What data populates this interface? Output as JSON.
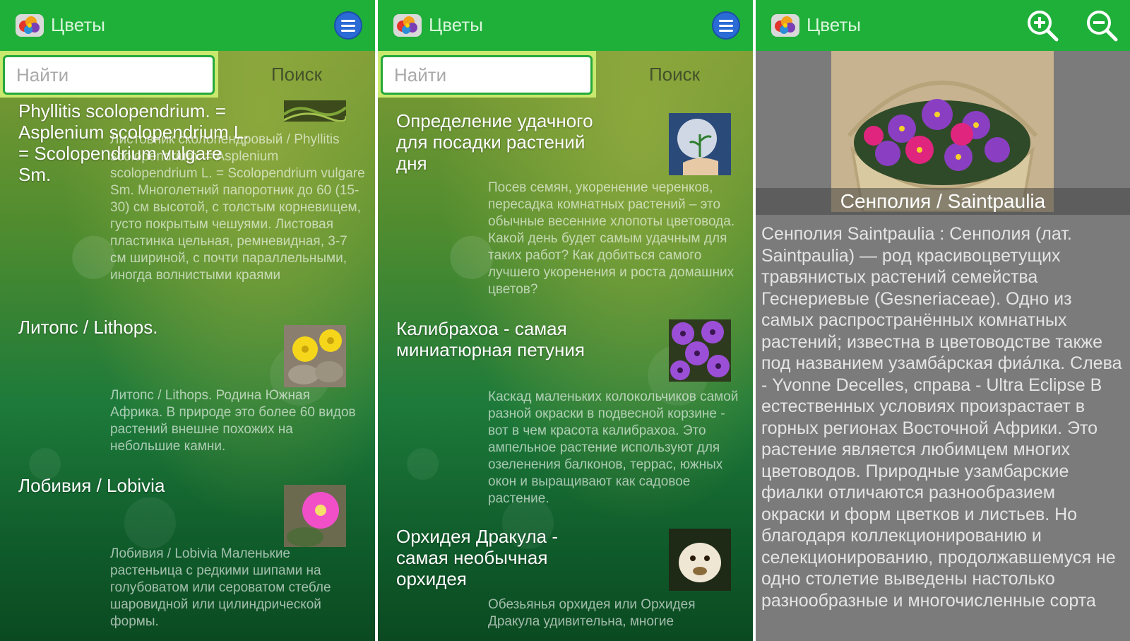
{
  "app": {
    "title": "Цветы",
    "colors": {
      "appbar": "#1fb03a",
      "search_bg": "#c8e86e",
      "detail_bg": "#7b7b7b"
    }
  },
  "search": {
    "placeholder": "Найти",
    "button_label": "Поиск"
  },
  "panel1": {
    "items": [
      {
        "title": "Phyllitis scolopendrium. = Asplenium scolopendrium L. = Scolopendrium vulgare Sm.",
        "description": "Листовник сколопендровый / Phyllitis scolopendrium. = Asplenium scolopendrium L. = Scolopendrium vulgare Sm. Многолетний папоротник до 60 (15-30) см высотой, с толстым корневищем, густо покрытым чешуями. Листовая пластинка цельная, ремневидная, 3-7 см шириной, с почти параллельными, иногда волнистыми краями",
        "thumb": "fern"
      },
      {
        "title": "Литопс / Lithops.",
        "description": "Литопс / Lithops. Родина Южная Африка. В природе это более 60 видов растений внешне похожих на небольшие камни.",
        "thumb": "lithops"
      },
      {
        "title": "Лобивия  / Lobivia",
        "description": "Лобивия / Lobivia Маленькие растеньица с редкими шипами на голубоватом или сероватом стебле шаровидной или цилиндрической формы.",
        "thumb": "lobivia"
      }
    ]
  },
  "panel2": {
    "items": [
      {
        "title": "Определение удачного для посадки растений дня",
        "description": "Посев семян, укоренение черенков, пересадка комнатных растений – это обычные весенние хлопоты цветовода. Какой день будет самым удачным для таких работ? Как добиться самого лучшего укоренения и роста домашних цветов?",
        "thumb": "moon-sprout"
      },
      {
        "title": "Калибрахоа - самая миниатюрная петуния",
        "description": "Каскад маленьких колокольчиков самой разной окраски в подвесной корзине - вот в чем красота калибрахоа. Это ампельное растение используют для озеленения балконов, террас, южных окон и выращивают как садовое растение.",
        "thumb": "calibrachoa"
      },
      {
        "title": "Орхидея Дракула - самая необычная орхидея",
        "description": "Обезьянья орхидея или Орхидея Дракула удивительна, многие",
        "thumb": "dracula-orchid"
      }
    ]
  },
  "detail": {
    "caption": "Сенполия / Saintpaulia",
    "text": "Сенполия Saintpaulia : Сенполия (лат. Saintpaulia) — род красивоцветущих травянистых растений семейства Геснериевые (Gesneriaceae). Одно из самых распространённых комнатных растений; известна в цветоводстве также под названием узамба́рская фиа́лка. Слева - Yvonne Decelles, справа - Ultra Eclipse   В естественных условиях произрастает в горных регионах Восточной Африки. Это растение является любимцем многих цветоводов. Природные узамбарские фиалки отличаются разнообразием окраски и форм цветков и листьев. Но благодаря коллекционированию и селекционированию, продолжавшемуся не одно столетие выведены настолько разнообразные и многочисленные сорта",
    "icons": [
      "zoom-in-icon",
      "zoom-out-icon"
    ]
  }
}
